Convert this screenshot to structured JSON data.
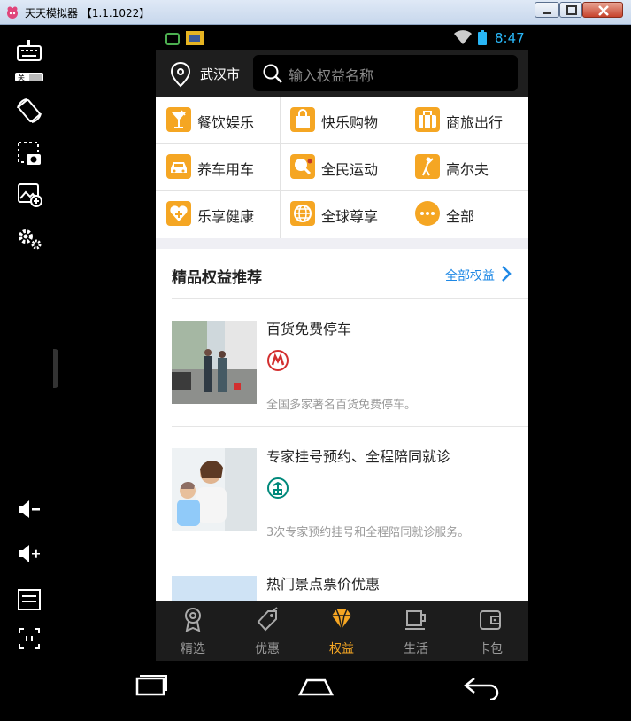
{
  "window": {
    "title": "天天模拟器 【1.1.1022】"
  },
  "toolbar": {
    "keyboard_badge": "关",
    "items": [
      "keyboard-icon",
      "rotate-icon",
      "screenshot-icon",
      "add-image-icon",
      "settings-icon",
      "volume-down-icon",
      "volume-up-icon",
      "menu-icon",
      "fit-screen-icon"
    ]
  },
  "statusbar": {
    "time": "8:47"
  },
  "header": {
    "city": "武汉市",
    "search_placeholder": "输入权益名称"
  },
  "categories": [
    {
      "label": "餐饮娱乐",
      "icon": "cocktail-icon"
    },
    {
      "label": "快乐购物",
      "icon": "shopping-bag-icon"
    },
    {
      "label": "商旅出行",
      "icon": "briefcase-icon"
    },
    {
      "label": "养车用车",
      "icon": "car-icon"
    },
    {
      "label": "全民运动",
      "icon": "ping-pong-icon"
    },
    {
      "label": "高尔夫",
      "icon": "golf-icon"
    },
    {
      "label": "乐享健康",
      "icon": "health-heart-icon"
    },
    {
      "label": "全球尊享",
      "icon": "globe-icon"
    },
    {
      "label": "全部",
      "icon": "more-icon"
    }
  ],
  "recommend": {
    "title": "精品权益推荐",
    "all_link": "全部权益",
    "items": [
      {
        "title": "百货免费停车",
        "desc": "全国多家著名百货免费停车。",
        "bank_logo": "cmb-logo"
      },
      {
        "title": "专家挂号预约、全程陪同就诊",
        "desc": "3次专家预约挂号和全程陪同就诊服务。",
        "bank_logo": "abc-logo"
      },
      {
        "title": "热门景点票价优惠",
        "desc": "",
        "bank_logo": ""
      }
    ]
  },
  "tabs": [
    {
      "label": "精选",
      "icon": "badge-icon",
      "active": false
    },
    {
      "label": "优惠",
      "icon": "tag-icon",
      "active": false
    },
    {
      "label": "权益",
      "icon": "diamond-icon",
      "active": true
    },
    {
      "label": "生活",
      "icon": "coffee-cup-icon",
      "active": false
    },
    {
      "label": "卡包",
      "icon": "wallet-icon",
      "active": false
    }
  ],
  "colors": {
    "accent": "#f5a623",
    "link": "#1e88e5",
    "header_bg": "#1e1e1e",
    "tabbar_bg": "#1c1c1c"
  }
}
